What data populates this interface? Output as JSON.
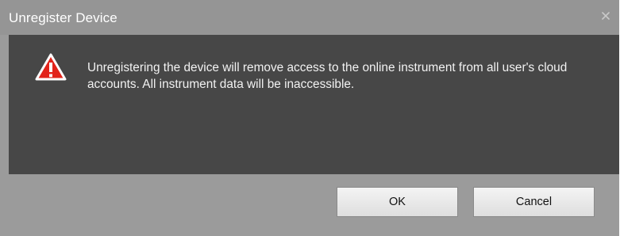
{
  "dialog": {
    "title": "Unregister Device",
    "close_symbol": "×",
    "icon": "warning-icon",
    "message": "Unregistering the device will remove access to the online instrument from all user's cloud accounts. All instrument data will be inaccessible.",
    "ok_label": "OK",
    "cancel_label": "Cancel"
  },
  "colors": {
    "title_bar": "#959595",
    "body_panel": "#474747",
    "footer": "#9b9b9b",
    "warning_red": "#e2231a"
  }
}
